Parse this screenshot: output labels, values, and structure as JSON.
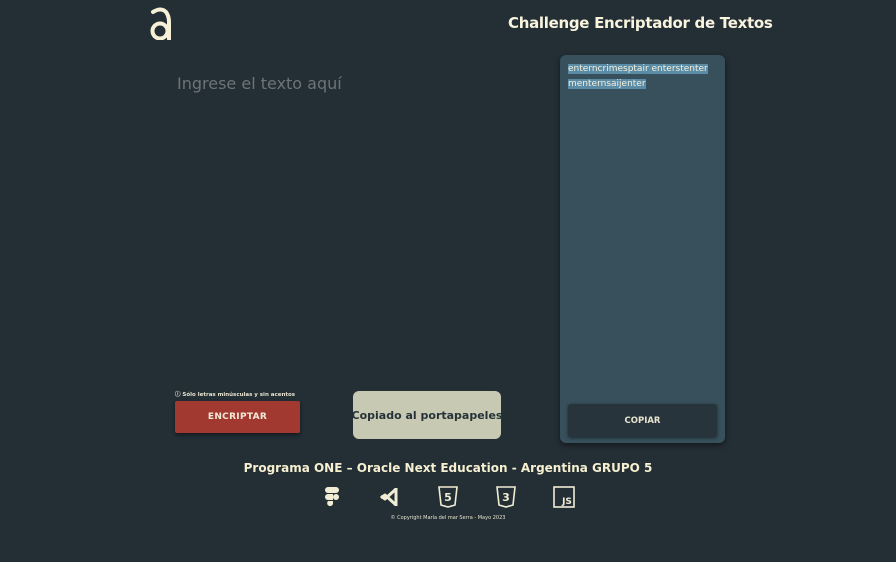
{
  "header": {
    "logo": "alura-logo-icon",
    "title": "Challenge Encriptador de Textos"
  },
  "input": {
    "placeholder": "Ingrese el texto aquí",
    "value": ""
  },
  "hint": "Sólo letras minúsculas y sin acentos",
  "buttons": {
    "encrypt": "ENCRIPTAR",
    "copy": "COPIAR"
  },
  "toast": "Copiado al portapapeles",
  "output": {
    "line1": "enterncrimesptair enterstenter",
    "line2": "menternsaijenter"
  },
  "footer": {
    "title": "Programa ONE – Oracle Next Education - Argentina GRUPO 5",
    "icons": [
      "figma-icon",
      "vscode-icon",
      "html5-icon",
      "css3-icon",
      "javascript-icon"
    ],
    "copyright": "© Copyright María del mar Serra - Mayo 2023"
  },
  "colors": {
    "background": "#232e35",
    "accent": "#a23931",
    "panel": "#37505c",
    "text": "#f6f3df",
    "selection": "#5b8ca6"
  }
}
